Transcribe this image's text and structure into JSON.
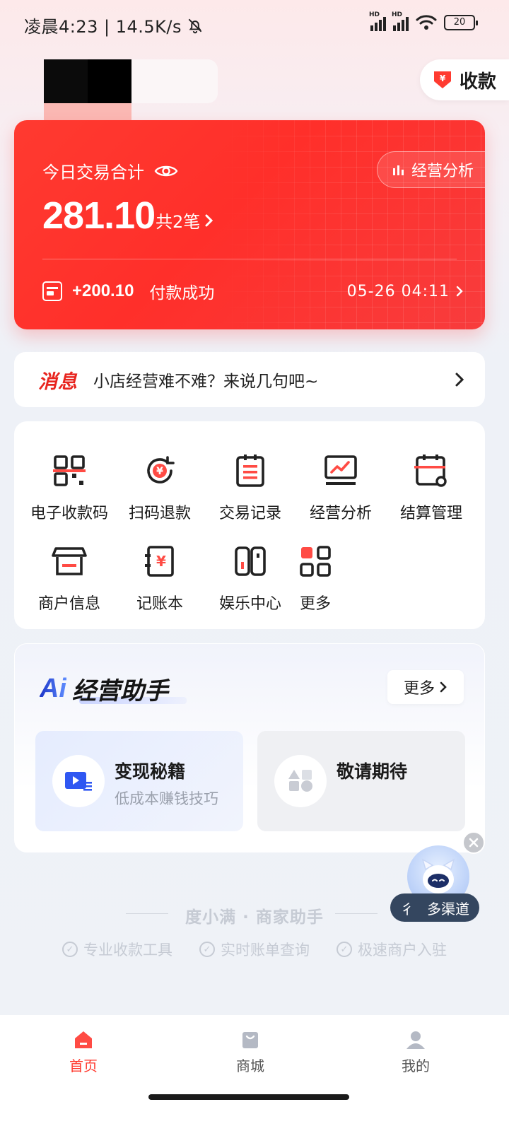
{
  "status_bar": {
    "time_speed": "凌晨4:23 | 14.5K/s",
    "signal_1": "HD",
    "signal_2": "HD",
    "battery": "20"
  },
  "header": {
    "collect_label": "收款"
  },
  "summary": {
    "title": "今日交易合计",
    "analysis_label": "经营分析",
    "amount": "281.10",
    "count": "共2笔",
    "last_txn_amount": "+200.10",
    "last_txn_status": "付款成功",
    "last_txn_time": "05-26 04:11"
  },
  "message": {
    "tag": "消息",
    "text": "小店经营难不难？来说几句吧~"
  },
  "functions": [
    {
      "label": "电子收款码",
      "icon": "qr-code-icon"
    },
    {
      "label": "扫码退款",
      "icon": "refund-icon"
    },
    {
      "label": "交易记录",
      "icon": "records-icon"
    },
    {
      "label": "经营分析",
      "icon": "chart-monitor-icon"
    },
    {
      "label": "结算管理",
      "icon": "settlement-icon"
    },
    {
      "label": "商户信息",
      "icon": "store-icon"
    },
    {
      "label": "记账本",
      "icon": "ledger-icon"
    },
    {
      "label": "娱乐中心",
      "icon": "game-icon"
    },
    {
      "label": "更多",
      "icon": "grid-icon"
    }
  ],
  "ai_assistant": {
    "mark": "Ai",
    "title": "经营助手",
    "more_label": "更多",
    "tiles": [
      {
        "title": "变现秘籍",
        "subtitle": "低成本赚钱技巧",
        "icon": "video-icon"
      },
      {
        "title": "敬请期待",
        "subtitle": "",
        "icon": "shapes-icon"
      }
    ]
  },
  "floating": {
    "pill_text_a": "彳",
    "pill_text_b": "多渠道"
  },
  "footer": {
    "brand": "度小满 · 商家助手",
    "features": [
      "专业收款工具",
      "实时账单查询",
      "极速商户入驻"
    ]
  },
  "tabs": [
    {
      "label": "首页",
      "active": true
    },
    {
      "label": "商城",
      "active": false
    },
    {
      "label": "我的",
      "active": false
    }
  ],
  "colors": {
    "accent": "#ff3a30",
    "message_tag": "#e8251f",
    "ai_blue": "#1f3fcf"
  }
}
